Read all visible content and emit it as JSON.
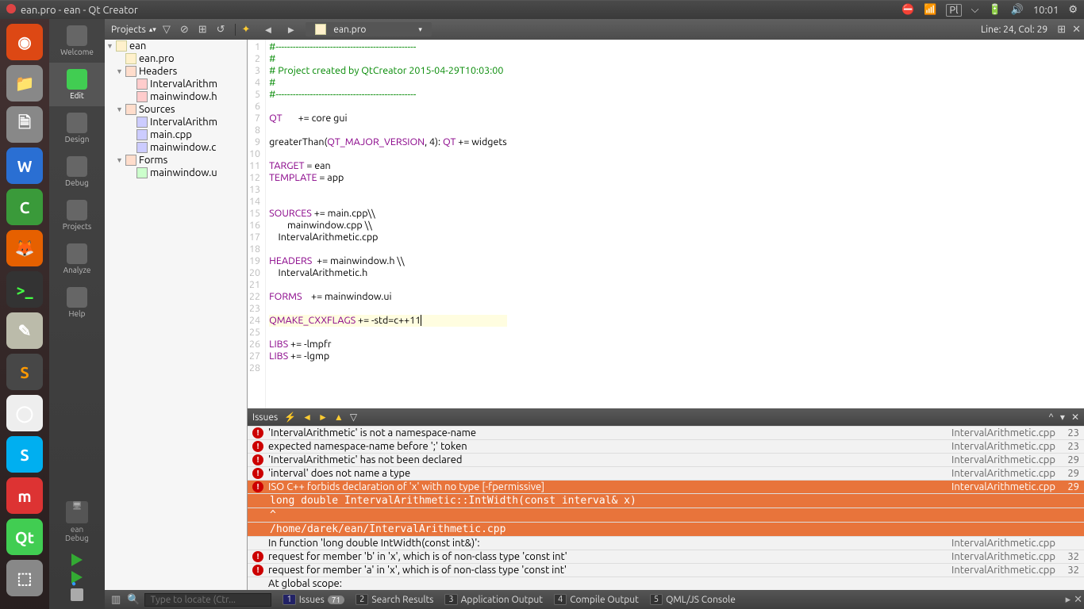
{
  "titlebar": {
    "title": "ean.pro - ean - Qt Creator",
    "lang": "Pl",
    "time": "10:01"
  },
  "modebar": {
    "items": [
      "Welcome",
      "Edit",
      "Design",
      "Debug",
      "Projects",
      "Analyze",
      "Help"
    ],
    "active": 1,
    "kit_name": "ean",
    "kit_config": "Debug"
  },
  "topbar": {
    "selector": "Projects",
    "file": "ean.pro",
    "cursor": "Line: 24, Col: 29"
  },
  "tree": [
    {
      "ind": 0,
      "arrow": "▼",
      "cls": "proj",
      "label": "ean"
    },
    {
      "ind": 1,
      "arrow": "",
      "cls": "proj",
      "label": "ean.pro"
    },
    {
      "ind": 1,
      "arrow": "▼",
      "cls": "fold",
      "label": "Headers"
    },
    {
      "ind": 2,
      "arrow": "",
      "cls": "h",
      "label": "IntervalArithm"
    },
    {
      "ind": 2,
      "arrow": "",
      "cls": "h",
      "label": "mainwindow.h"
    },
    {
      "ind": 1,
      "arrow": "▼",
      "cls": "fold",
      "label": "Sources"
    },
    {
      "ind": 2,
      "arrow": "",
      "cls": "cpp",
      "label": "IntervalArithm"
    },
    {
      "ind": 2,
      "arrow": "",
      "cls": "cpp",
      "label": "main.cpp"
    },
    {
      "ind": 2,
      "arrow": "",
      "cls": "cpp",
      "label": "mainwindow.c"
    },
    {
      "ind": 1,
      "arrow": "▼",
      "cls": "fold",
      "label": "Forms"
    },
    {
      "ind": 2,
      "arrow": "",
      "cls": "ui",
      "label": "mainwindow.u"
    }
  ],
  "code_lines": [
    {
      "n": 1,
      "html": "<span class='c-cmt'>#-------------------------------------------------</span>"
    },
    {
      "n": 2,
      "html": "<span class='c-cmt'>#</span>"
    },
    {
      "n": 3,
      "html": "<span class='c-cmt'># Project created by QtCreator 2015-04-29T10:03:00</span>"
    },
    {
      "n": 4,
      "html": "<span class='c-cmt'>#</span>"
    },
    {
      "n": 5,
      "html": "<span class='c-cmt'>#-------------------------------------------------</span>"
    },
    {
      "n": 6,
      "html": ""
    },
    {
      "n": 7,
      "html": "<span class='c-kw'>QT</span>       += core gui"
    },
    {
      "n": 8,
      "html": ""
    },
    {
      "n": 9,
      "html": "greaterThan(<span class='c-kw'>QT_MAJOR_VERSION</span>, 4): <span class='c-kw'>QT</span> += widgets"
    },
    {
      "n": 10,
      "html": ""
    },
    {
      "n": 11,
      "html": "<span class='c-kw'>TARGET</span> = ean"
    },
    {
      "n": 12,
      "html": "<span class='c-kw'>TEMPLATE</span> = app"
    },
    {
      "n": 13,
      "html": ""
    },
    {
      "n": 14,
      "html": ""
    },
    {
      "n": 15,
      "html": "<span class='c-kw'>SOURCES</span> += main.cpp\\\\"
    },
    {
      "n": 16,
      "html": "        mainwindow.cpp \\\\"
    },
    {
      "n": 17,
      "html": "    IntervalArithmetic.cpp"
    },
    {
      "n": 18,
      "html": ""
    },
    {
      "n": 19,
      "html": "<span class='c-kw'>HEADERS</span>  += mainwindow.h \\\\"
    },
    {
      "n": 20,
      "html": "    IntervalArithmetic.h"
    },
    {
      "n": 21,
      "html": ""
    },
    {
      "n": 22,
      "html": "<span class='c-kw'>FORMS</span>    += mainwindow.ui"
    },
    {
      "n": 23,
      "html": ""
    },
    {
      "n": 24,
      "html": "<span class='c-kw'>QMAKE_CXXFLAGS</span> += -std=c++11",
      "current": true
    },
    {
      "n": 25,
      "html": ""
    },
    {
      "n": 26,
      "html": "<span class='c-kw'>LIBS</span> += -lmpfr"
    },
    {
      "n": 27,
      "html": "<span class='c-kw'>LIBS</span> += -lgmp"
    },
    {
      "n": 28,
      "html": ""
    }
  ],
  "issuespanel": {
    "title": "Issues"
  },
  "issues": [
    {
      "t": "err",
      "msg": "'IntervalArithmetic' is not a namespace-name",
      "file": "IntervalArithmetic.cpp",
      "line": 23
    },
    {
      "t": "err",
      "msg": "expected namespace-name before ';' token",
      "file": "IntervalArithmetic.cpp",
      "line": 23
    },
    {
      "t": "err",
      "msg": "'IntervalArithmetic' has not been declared",
      "file": "IntervalArithmetic.cpp",
      "line": 29
    },
    {
      "t": "err",
      "msg": "'interval' does not name a type",
      "file": "IntervalArithmetic.cpp",
      "line": 29
    },
    {
      "t": "err",
      "sel": true,
      "msg": "ISO C++ forbids declaration of 'x' with no type [-fpermissive]",
      "file": "IntervalArithmetic.cpp",
      "line": 29,
      "sub": [
        " long double IntervalArithmetic::IntWidth(const interval& x)",
        "                                                         ^",
        "/home/darek/ean/IntervalArithmetic.cpp"
      ]
    },
    {
      "t": "info",
      "msg": "In function 'long double IntWidth(const int&)':",
      "file": "IntervalArithmetic.cpp",
      "line": ""
    },
    {
      "t": "err",
      "msg": "request for member 'b' in 'x', which is of non-class type 'const int'",
      "file": "IntervalArithmetic.cpp",
      "line": 32
    },
    {
      "t": "err",
      "msg": "request for member 'a' in 'x', which is of non-class type 'const int'",
      "file": "IntervalArithmetic.cpp",
      "line": 32
    },
    {
      "t": "info",
      "msg": "At global scope:",
      "file": "",
      "line": ""
    }
  ],
  "locator_placeholder": "Type to locate (Ctr...",
  "bottom_panes": [
    {
      "n": "1",
      "label": "Issues",
      "badge": "71",
      "active": true
    },
    {
      "n": "2",
      "label": "Search Results"
    },
    {
      "n": "3",
      "label": "Application Output"
    },
    {
      "n": "4",
      "label": "Compile Output"
    },
    {
      "n": "5",
      "label": "QML/JS Console"
    }
  ]
}
